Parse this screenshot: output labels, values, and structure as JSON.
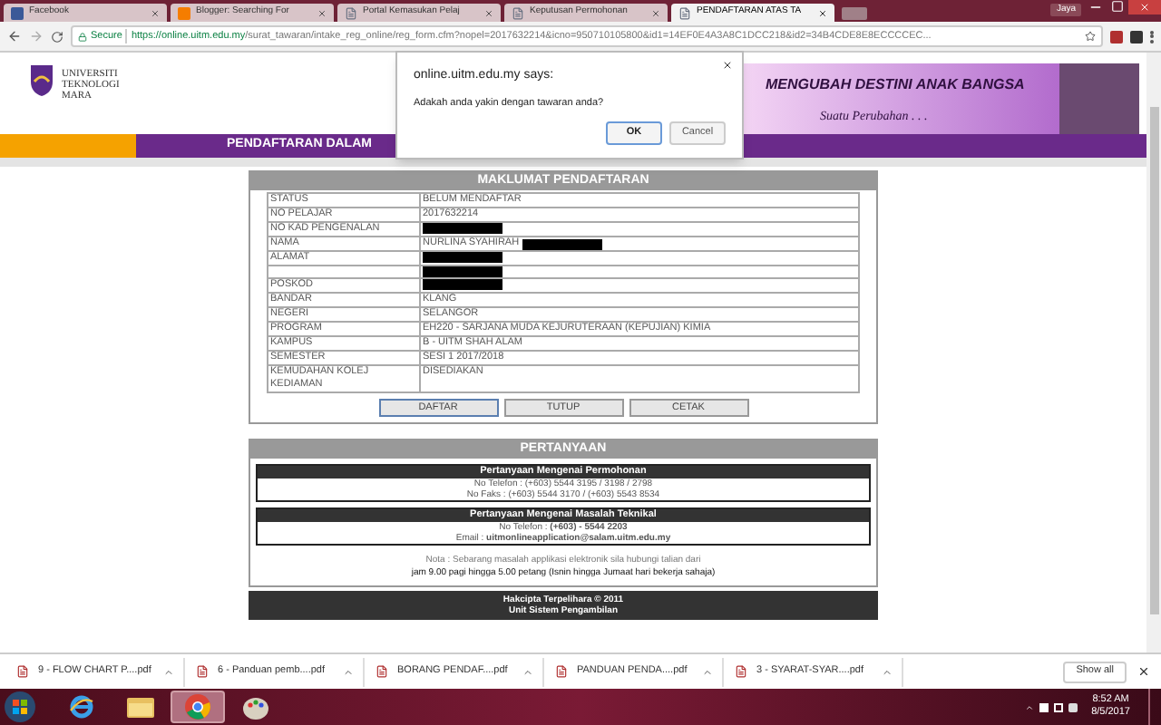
{
  "browser": {
    "tabs": [
      {
        "title": "Facebook",
        "selected": false,
        "kind": "facebook"
      },
      {
        "title": "Blogger: Searching For",
        "selected": false,
        "kind": "blogger"
      },
      {
        "title": "Portal Kemasukan Pelaj",
        "selected": false,
        "kind": "page"
      },
      {
        "title": "Keputusan Permohonan",
        "selected": false,
        "kind": "page"
      },
      {
        "title": "PENDAFTARAN ATAS TA",
        "selected": true,
        "kind": "page"
      }
    ],
    "profile": "Jaya",
    "secure_label": "Secure",
    "url_host": "https://online.uitm.edu.my",
    "url_path": "/surat_tawaran/intake_reg_online/reg_form.cfm?nopel=2017632214&icno=950710105800&id1=14EF0E4A3A8C1DCC218&id2=34B4CDE8E8ECCCCEC..."
  },
  "dialog": {
    "origin": "online.uitm.edu.my says:",
    "message": "Adakah anda yakin dengan tawaran anda?",
    "buttons": [
      {
        "label": "OK",
        "focused": true
      },
      {
        "label": "Cancel",
        "focused": false
      }
    ]
  },
  "header": {
    "logo_lines": [
      "UNIVERSITI",
      "TEKNOLOGI",
      "MARA"
    ],
    "banner_headline": "MENGUBAH DESTINI ANAK BANGSA",
    "banner_tagline": "Suatu Perubahan . . ."
  },
  "title_bar": "PENDAFTARAN DALAM",
  "registration": {
    "heading": "MAKLUMAT PENDAFTARAN",
    "rows": [
      {
        "label": "STATUS",
        "value": "BELUM MENDAFTAR",
        "redacted": false
      },
      {
        "label": "NO PELAJAR",
        "value": "2017632214",
        "redacted": false
      },
      {
        "label": "NO KAD PENGENALAN",
        "redacted": true
      },
      {
        "label": "NAMA",
        "value": "NURLINA SYAHIRAH",
        "redacted": true
      },
      {
        "label": "ALAMAT",
        "redacted": true
      },
      {
        "redacted": true
      },
      {
        "label": "POSKOD",
        "redacted": true
      },
      {
        "label": "BANDAR",
        "value": "KLANG",
        "redacted": false
      },
      {
        "label": "NEGERI",
        "value": "SELANGOR",
        "redacted": false
      },
      {
        "label": "PROGRAM",
        "value": "EH220 - SARJANA MUDA KEJURUTERAAN (KEPUJIAN) KIMIA",
        "redacted": false
      },
      {
        "label": "KAMPUS",
        "value": "B - UITM SHAH ALAM",
        "redacted": false
      },
      {
        "label": "SEMESTER",
        "value": "SESI 1 2017/2018",
        "redacted": false
      },
      {
        "label": "KEMUDAHAN KOLEJ KEDIAMAN",
        "value": "DISEDIAKAN",
        "redacted": false
      }
    ],
    "actions": [
      {
        "label": "DAFTAR",
        "focused": true
      },
      {
        "label": "TUTUP",
        "focused": false
      },
      {
        "label": "CETAK",
        "focused": false
      }
    ]
  },
  "enquiry": {
    "heading": "PERTANYAAN",
    "sections": [
      {
        "title": "Pertanyaan Mengenai Permohonan",
        "lines": [
          "No Telefon : (+603) 5544 3195 / 3198 / 2798",
          "No Faks : (+603) 5544 3170 / (+603) 5543 8534"
        ]
      },
      {
        "title": "Pertanyaan Mengenai Masalah Teknikal",
        "lines": [
          "No Telefon : **(+603) - 5544 2203**",
          "Email : **uitmonlineapplication@salam.uitm.edu.my**"
        ]
      }
    ],
    "note": [
      {
        "text": "Nota : Sebarang masalah applikasi elektronik sila hubungi talian dari",
        "strong": false
      },
      {
        "text": "jam 9.00 pagi hingga 5.00 petang (Isnin hingga Jumaat hari bekerja sahaja)",
        "strong": true
      }
    ]
  },
  "footer": [
    "Hakcipta Terpelihara © 2011",
    "Unit Sistem Pengambilan"
  ],
  "downloads": {
    "items": [
      "9 - FLOW CHART P....pdf",
      "6 - Panduan pemb....pdf",
      "BORANG PENDAF....pdf",
      "PANDUAN PENDA....pdf",
      "3 - SYARAT-SYAR....pdf"
    ],
    "show_all": "Show all"
  },
  "taskbar": {
    "apps": [
      {
        "kind": "ie",
        "active": false
      },
      {
        "kind": "folder",
        "active": false
      },
      {
        "kind": "chrome",
        "active": true
      },
      {
        "kind": "paint",
        "active": false
      }
    ],
    "time": "8:52 AM",
    "date": "8/5/2017"
  }
}
